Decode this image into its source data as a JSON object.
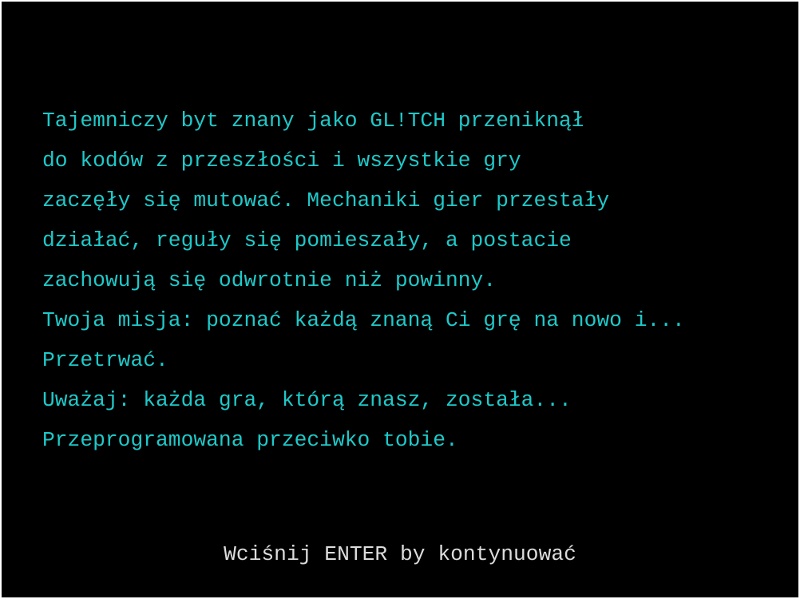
{
  "intro": {
    "lines": [
      "Tajemniczy byt znany jako GL!TCH przeniknął",
      "do kodów z przeszłości i wszystkie gry",
      "zaczęły się mutować. Mechaniki gier przestały",
      "działać, reguły się pomieszały, a postacie",
      "zachowują się odwrotnie niż powinny.",
      "Twoja misja: poznać każdą znaną Ci grę na nowo i...",
      "Przetrwać.",
      "Uważaj: każda gra, którą znasz, została...",
      "Przeprogramowana przeciwko tobie."
    ],
    "prompt": "Wciśnij ENTER by kontynuować"
  },
  "colors": {
    "background": "#000000",
    "story_text": "#1fc9c9",
    "prompt_text": "#dcdcdc"
  }
}
